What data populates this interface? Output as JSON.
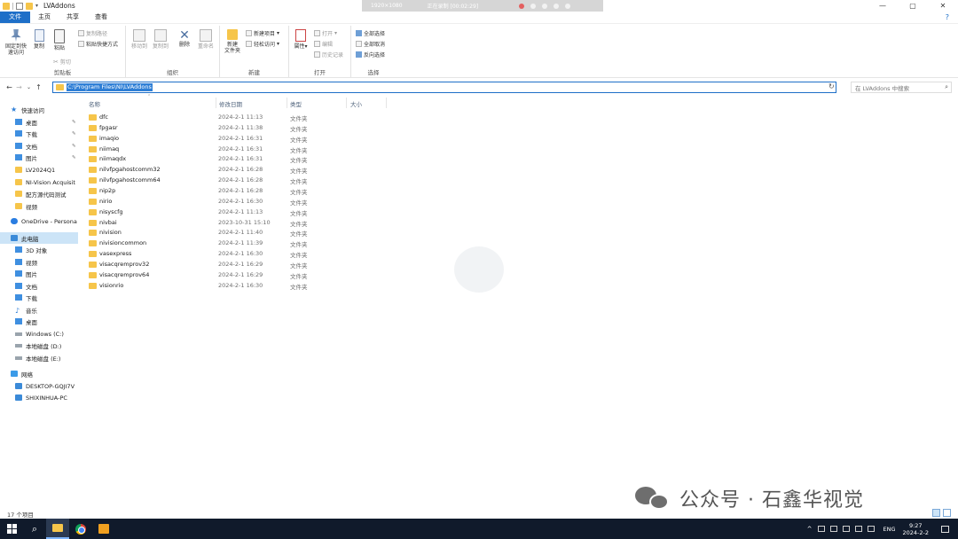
{
  "window": {
    "title": "LVAddons",
    "controls": [
      "—",
      "▢",
      "✕"
    ]
  },
  "recorder": {
    "resolution": "1920×1080",
    "status": "正在录制 [00:02:29]"
  },
  "tabs": [
    "文件",
    "主页",
    "共享",
    "查看"
  ],
  "help_glyph": "?",
  "ribbon": {
    "clipboard": {
      "label": "剪贴板",
      "pin": "固定到快\n速访问",
      "copy": "复制",
      "paste": "粘贴",
      "copy_path": "复制路径",
      "paste_shortcut": "粘贴快捷方式",
      "cut": "剪切"
    },
    "organize": {
      "label": "组织",
      "move_to": "移动到",
      "copy_to": "复制到",
      "delete": "删除",
      "rename": "重命名"
    },
    "new": {
      "label": "新建",
      "new_folder": "新建\n文件夹",
      "new_item": "新建项目",
      "easy_access": "轻松访问"
    },
    "open": {
      "label": "打开",
      "properties": "属性",
      "open": "打开",
      "edit": "编辑",
      "history": "历史记录"
    },
    "select": {
      "label": "选择",
      "select_all": "全部选择",
      "select_none": "全部取消",
      "invert": "反向选择"
    }
  },
  "address": {
    "path": "C:\\Program Files\\NI\\LVAddons",
    "search_placeholder": "在 LVAddons 中搜索"
  },
  "sidebar": {
    "items": [
      {
        "label": "快速访问",
        "icon": "star-icon"
      },
      {
        "label": "桌面",
        "icon": "desktop-icon",
        "pinned": true
      },
      {
        "label": "下载",
        "icon": "download-icon",
        "pinned": true
      },
      {
        "label": "文档",
        "icon": "documents-icon",
        "pinned": true
      },
      {
        "label": "图片",
        "icon": "pictures-icon",
        "pinned": true
      },
      {
        "label": "LV2024Q1",
        "icon": "folder-icon"
      },
      {
        "label": "NI-Vision Acquisit",
        "icon": "folder-icon"
      },
      {
        "label": "配方源代码测试",
        "icon": "folder-icon"
      },
      {
        "label": "视频",
        "icon": "folder-icon"
      },
      {
        "label": "OneDrive - Persona",
        "icon": "cloud-icon"
      },
      {
        "label": "此电脑",
        "icon": "computer-icon",
        "selected": true
      },
      {
        "label": "3D 对象",
        "icon": "3d-objects-icon"
      },
      {
        "label": "视频",
        "icon": "videos-icon"
      },
      {
        "label": "图片",
        "icon": "pictures-icon"
      },
      {
        "label": "文档",
        "icon": "documents-icon"
      },
      {
        "label": "下载",
        "icon": "download-icon"
      },
      {
        "label": "音乐",
        "icon": "music-icon"
      },
      {
        "label": "桌面",
        "icon": "desktop-icon"
      },
      {
        "label": "Windows (C:)",
        "icon": "drive-icon"
      },
      {
        "label": "本地磁盘 (D:)",
        "icon": "drive-icon"
      },
      {
        "label": "本地磁盘 (E:)",
        "icon": "drive-icon"
      },
      {
        "label": "网络",
        "icon": "network-icon"
      },
      {
        "label": "DESKTOP-GQJI7V",
        "icon": "network-computer-icon"
      },
      {
        "label": "SHIXINHUA-PC",
        "icon": "network-computer-icon"
      }
    ]
  },
  "columns": {
    "name": "名称",
    "date": "修改日期",
    "type": "类型",
    "size": "大小"
  },
  "files": [
    {
      "name": "dfc",
      "date": "2024-2-1 11:13",
      "type": "文件夹"
    },
    {
      "name": "fpgasr",
      "date": "2024-2-1 11:38",
      "type": "文件夹"
    },
    {
      "name": "imaqio",
      "date": "2024-2-1 16:31",
      "type": "文件夹"
    },
    {
      "name": "niimaq",
      "date": "2024-2-1 16:31",
      "type": "文件夹"
    },
    {
      "name": "niimaqdx",
      "date": "2024-2-1 16:31",
      "type": "文件夹"
    },
    {
      "name": "nilvfpgahostcomm32",
      "date": "2024-2-1 16:28",
      "type": "文件夹"
    },
    {
      "name": "nilvfpgahostcomm64",
      "date": "2024-2-1 16:28",
      "type": "文件夹"
    },
    {
      "name": "nip2p",
      "date": "2024-2-1 16:28",
      "type": "文件夹"
    },
    {
      "name": "nirio",
      "date": "2024-2-1 16:30",
      "type": "文件夹"
    },
    {
      "name": "nisyscfg",
      "date": "2024-2-1 11:13",
      "type": "文件夹"
    },
    {
      "name": "nivbai",
      "date": "2023-10-31 15:10",
      "type": "文件夹"
    },
    {
      "name": "nivision",
      "date": "2024-2-1 11:40",
      "type": "文件夹"
    },
    {
      "name": "nivisioncommon",
      "date": "2024-2-1 11:39",
      "type": "文件夹"
    },
    {
      "name": "vasexpress",
      "date": "2024-2-1 16:30",
      "type": "文件夹"
    },
    {
      "name": "visacqremprov32",
      "date": "2024-2-1 16:29",
      "type": "文件夹"
    },
    {
      "name": "visacqremprov64",
      "date": "2024-2-1 16:29",
      "type": "文件夹"
    },
    {
      "name": "visionrio",
      "date": "2024-2-1 16:30",
      "type": "文件夹"
    }
  ],
  "status": {
    "item_count": "17 个项目"
  },
  "watermark": "公众号 · 石鑫华视觉",
  "taskbar": {
    "lang": "ENG",
    "time": "9:27",
    "date": "2024-2-2",
    "tray_caret": "^"
  },
  "colors": {
    "accent": "#1e6fc8",
    "folder": "#f6c54a",
    "selection": "#cce4f7",
    "taskbar": "#101a2b"
  }
}
